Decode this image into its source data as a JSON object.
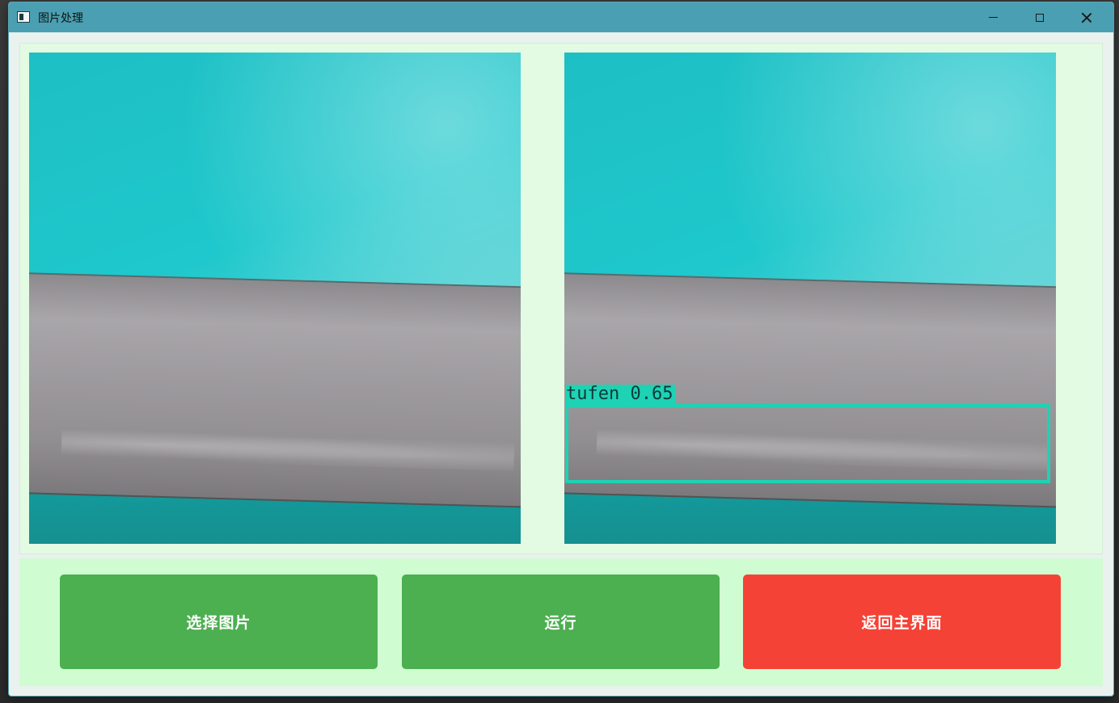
{
  "window": {
    "title": "图片处理",
    "controls": {
      "minimize_icon": "minimize-icon",
      "maximize_icon": "maximize-icon",
      "close_icon": "close-icon"
    }
  },
  "images": {
    "original": {
      "description_icon": "original-image"
    },
    "result": {
      "detections": [
        {
          "label": "tufen 0.65",
          "class": "tufen",
          "confidence": 0.65
        }
      ]
    }
  },
  "buttons": {
    "select_image": "选择图片",
    "run": "运行",
    "back_to_main": "返回主界面"
  },
  "colors": {
    "titlebar": "#4aa0b2",
    "image_panel_bg": "#e3fbe3",
    "button_panel_bg": "#d0fcd2",
    "primary_button": "#4caf50",
    "danger_button": "#f44336",
    "detection_box": "#1ed2b4"
  }
}
